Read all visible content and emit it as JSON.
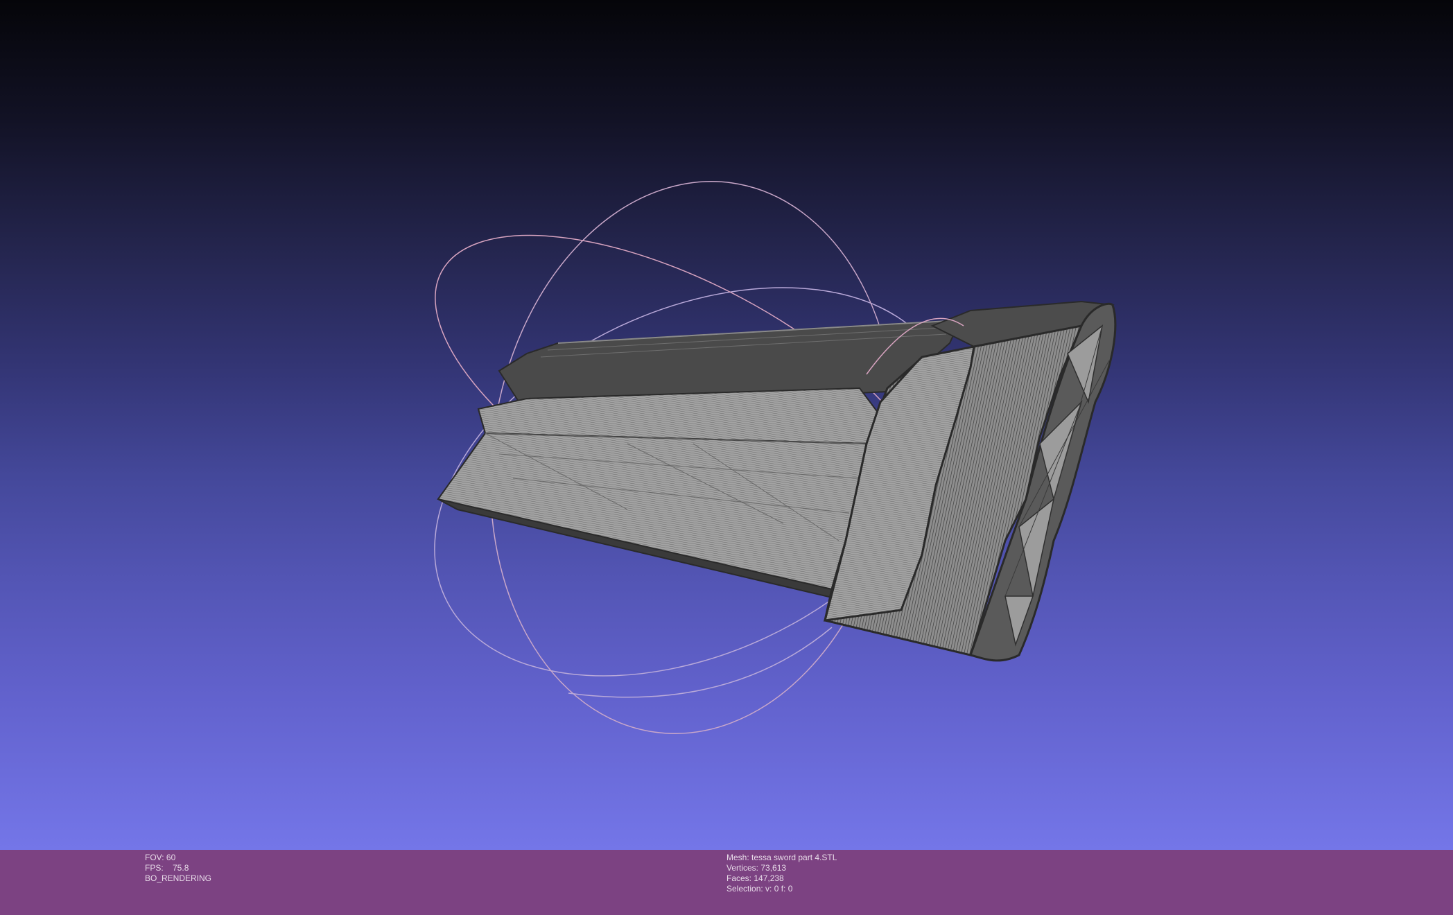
{
  "viewport": {
    "background_top": "#050509",
    "background_bottom": "#7476e8",
    "mesh_color": "#4a4a4a",
    "trackball_colors": [
      "#c9a7c9",
      "#b9a9d9",
      "#d8a4c0"
    ]
  },
  "status_bar": {
    "color": "#7c4282",
    "left": {
      "fov": "FOV: 60",
      "fps": "FPS:    75.8",
      "mode": "BO_RENDERING"
    },
    "right": {
      "mesh": "Mesh: tessa sword part 4.STL",
      "vertices": "Vertices: 73,613",
      "faces": "Faces: 147,238",
      "selection": "Selection: v: 0 f: 0"
    }
  }
}
